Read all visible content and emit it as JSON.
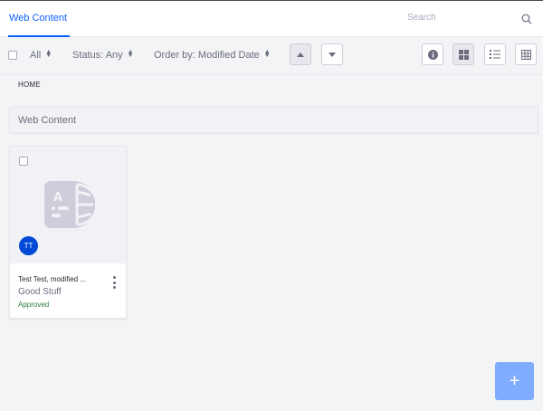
{
  "topbar": {
    "tab_label": "Web Content",
    "search_placeholder": "Search"
  },
  "management_bar": {
    "select_all_label": "All",
    "status_filter": "Status: Any",
    "order_by": "Order by: Modified Date"
  },
  "breadcrumb": {
    "home": "HOME"
  },
  "section": {
    "title": "Web Content"
  },
  "cards": [
    {
      "title": "Test Test, modified ...",
      "subtitle": "Good Stuff",
      "status": "Approved",
      "avatar_initials": "TT"
    }
  ],
  "fab": {
    "label": "+"
  },
  "colors": {
    "accent": "#0b5fff",
    "avatar": "#004ad7",
    "approved": "#287d3c",
    "fab": "#80acff"
  }
}
